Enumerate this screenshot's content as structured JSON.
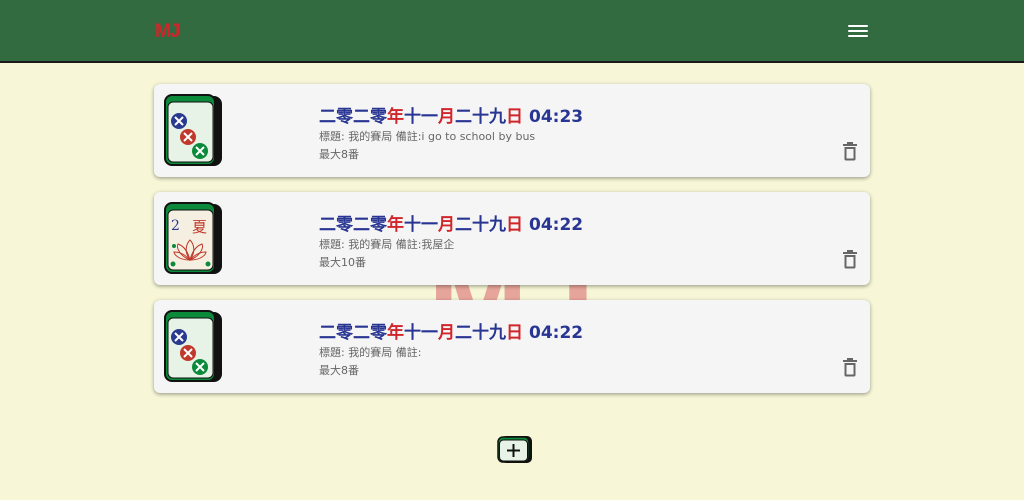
{
  "app": {
    "logo_text": "MJ",
    "menu_icon": "hamburger-menu-icon",
    "watermark_text": "MJ"
  },
  "colors": {
    "appbar": "#326b3f",
    "background": "#f7f7d7",
    "date_blue": "#283592",
    "date_red": "#d0252a"
  },
  "games": [
    {
      "tile": "three-circles-tile",
      "date": {
        "p1": "二零二零",
        "p2": "年",
        "p3": "十一",
        "p4": "月",
        "p5": "二十九",
        "p6": "日",
        "time": "04:23"
      },
      "meta_line1": "標題: 我的賽局 備註:i go to school by bus",
      "meta_line2": "最大8番"
    },
    {
      "tile": "summer-flower-tile",
      "tile_number": "2",
      "tile_char": "夏",
      "date": {
        "p1": "二零二零",
        "p2": "年",
        "p3": "十一",
        "p4": "月",
        "p5": "二十九",
        "p6": "日",
        "time": "04:22"
      },
      "meta_line1": "標題: 我的賽局 備註:我屋企",
      "meta_line2": "最大10番"
    },
    {
      "tile": "three-circles-tile",
      "date": {
        "p1": "二零二零",
        "p2": "年",
        "p3": "十一",
        "p4": "月",
        "p5": "二十九",
        "p6": "日",
        "time": "04:22"
      },
      "meta_line1": "標題: 我的賽局 備註:",
      "meta_line2": "最大8番"
    }
  ],
  "add_button_icon": "add-tile-icon",
  "delete_icon": "trash-icon"
}
